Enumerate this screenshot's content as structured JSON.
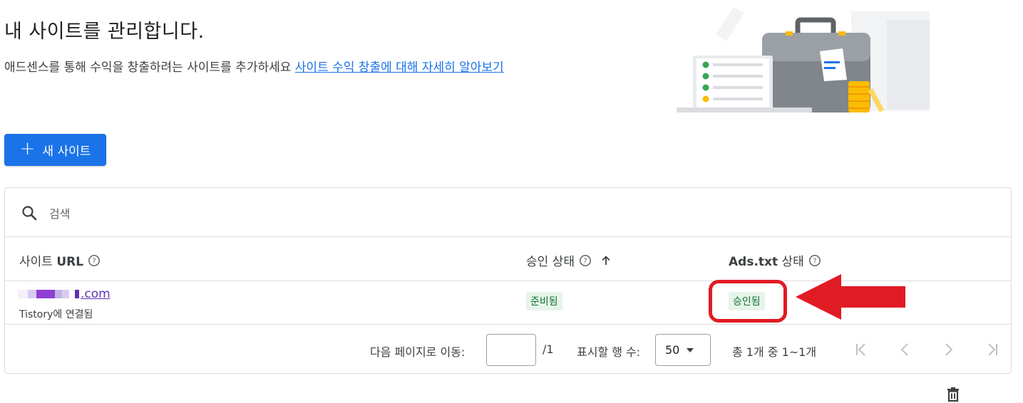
{
  "header": {
    "title": "내 사이트를 관리합니다.",
    "subtitle": "애드센스를 통해 수익을 창출하려는 사이트를 추가하세요",
    "learn_more_link": "사이트 수익 창출에 대해 자세히 알아보기"
  },
  "new_site_button": {
    "icon": "plus-icon",
    "label": "새 사이트"
  },
  "search": {
    "placeholder": "검색",
    "value": ""
  },
  "table": {
    "columns": {
      "site_url_prefix": "사이트 ",
      "site_url_bold": "URL",
      "approval_status": "승인 상태",
      "ads_txt_bold": "Ads.txt",
      "ads_txt_suffix": " 상태"
    },
    "rows": [
      {
        "site_url_visible": ".com",
        "site_sub": "Tistory에 연결됨",
        "approval_status": "준비됨",
        "ads_txt_status": "승인됨"
      }
    ]
  },
  "pagination": {
    "go_to_page_label": "다음 페이지로 이동:",
    "page_input_value": "",
    "total_pages": "/1",
    "rows_per_page_label": "표시할 행 수:",
    "rows_per_page_value": "50",
    "range_text": "총 1개 중 1~1개"
  },
  "colors": {
    "accent": "#1a73e8",
    "status_green_bg": "#e6f4ea",
    "status_green_text": "#137333",
    "annotation_red": "#e01b24"
  }
}
